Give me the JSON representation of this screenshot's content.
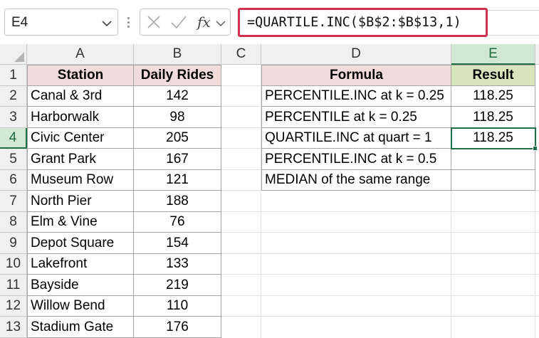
{
  "namebox": {
    "value": "E4",
    "caret_icon": "chevron-down-icon"
  },
  "formula_bar": {
    "cancel_icon": "close-icon",
    "enter_icon": "checkmark-icon",
    "fx_label": "fx",
    "expand_icon": "chevron-down-icon",
    "formula": "=QUARTILE.INC($B$2:$B$13,1)",
    "highlight_color": "#d0304f"
  },
  "columns": [
    "A",
    "B",
    "C",
    "D",
    "E"
  ],
  "active_column": "E",
  "active_row": "4",
  "rows": [
    "1",
    "2",
    "3",
    "4",
    "5",
    "6",
    "7",
    "8",
    "9",
    "10",
    "11",
    "12",
    "13"
  ],
  "table_left": {
    "headers": {
      "station": "Station",
      "daily_rides": "Daily Rides"
    },
    "header_color": "#f2dcdb",
    "rows": [
      {
        "station": "Canal & 3rd",
        "rides": "142"
      },
      {
        "station": "Harborwalk",
        "rides": "98"
      },
      {
        "station": "Civic Center",
        "rides": "205"
      },
      {
        "station": "Grant Park",
        "rides": "167"
      },
      {
        "station": "Museum Row",
        "rides": "121"
      },
      {
        "station": "North Pier",
        "rides": "188"
      },
      {
        "station": "Elm & Vine",
        "rides": "76"
      },
      {
        "station": "Depot Square",
        "rides": "154"
      },
      {
        "station": "Lakefront",
        "rides": "133"
      },
      {
        "station": "Bayside",
        "rides": "219"
      },
      {
        "station": "Willow Bend",
        "rides": "110"
      },
      {
        "station": "Stadium Gate",
        "rides": "176"
      }
    ]
  },
  "table_right": {
    "headers": {
      "formula": "Formula",
      "result": "Result"
    },
    "formula_header_color": "#f2dcdb",
    "result_header_color": "#d8e4bc",
    "rows": [
      {
        "formula": "PERCENTILE.INC at k = 0.25",
        "result": "118.25"
      },
      {
        "formula": "PERCENTILE at k = 0.25",
        "result": "118.25"
      },
      {
        "formula": "QUARTILE.INC at quart = 1",
        "result": "118.25"
      },
      {
        "formula": "PERCENTILE.INC at k = 0.5",
        "result": ""
      },
      {
        "formula": "MEDIAN of the same range",
        "result": ""
      }
    ]
  },
  "selection_color": "#1e7145"
}
